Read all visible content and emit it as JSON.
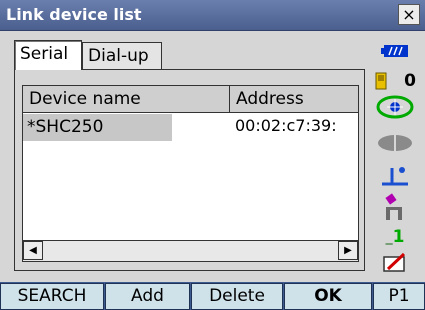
{
  "window": {
    "title": "Link device list",
    "close_label": "×"
  },
  "tabs": [
    {
      "label": "Serial",
      "selected": true
    },
    {
      "label": "Dial-up",
      "selected": false
    }
  ],
  "list": {
    "columns": [
      "Device name",
      "Address"
    ],
    "rows": [
      {
        "name": "*SHC250",
        "address": "00:02:c7:39:"
      }
    ]
  },
  "status": {
    "battery_icon": "battery-icon",
    "memory_count": "0",
    "target_icon": "target-icon",
    "laser_icon": "laser-icon",
    "tilt_icon": "tilt-icon",
    "station_icon": "station-icon",
    "input_mode": "1",
    "edit_icon": "edit-pencil-icon"
  },
  "softkeys": [
    "SEARCH",
    "Add",
    "Delete",
    "OK",
    "P1"
  ],
  "colors": {
    "titlebar": "#4a5f8e",
    "softkey_bg": "#cfe2ea",
    "bottombar": "#3e5a8e",
    "accent_blue": "#0033cc",
    "green": "#00aa00"
  }
}
